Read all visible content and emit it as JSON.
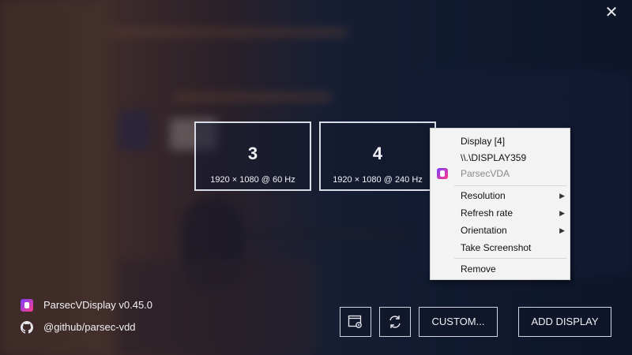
{
  "window": {
    "close_label": "✕"
  },
  "displays": [
    {
      "number": "3",
      "mode": "1920 × 1080 @ 60 Hz"
    },
    {
      "number": "4",
      "mode": "1920 × 1080 @ 240 Hz"
    }
  ],
  "context_menu": {
    "header_title": "Display [4]",
    "header_path": "\\\\.\\DISPLAY359",
    "header_device": "ParsecVDA",
    "items": [
      {
        "label": "Resolution",
        "has_submenu": true
      },
      {
        "label": "Refresh rate",
        "has_submenu": true
      },
      {
        "label": "Orientation",
        "has_submenu": true
      },
      {
        "label": "Take Screenshot",
        "has_submenu": false
      },
      {
        "label": "Remove",
        "has_submenu": false
      }
    ]
  },
  "footer": {
    "app_name": "ParsecVDisplay v0.45.0",
    "github_link": "@github/parsec-vdd",
    "custom_label": "CUSTOM...",
    "add_display_label": "ADD DISPLAY"
  },
  "icons": {
    "app": "parsec-vdisplay-icon",
    "github": "github-icon",
    "settings": "window-settings-icon",
    "refresh": "refresh-icon"
  }
}
